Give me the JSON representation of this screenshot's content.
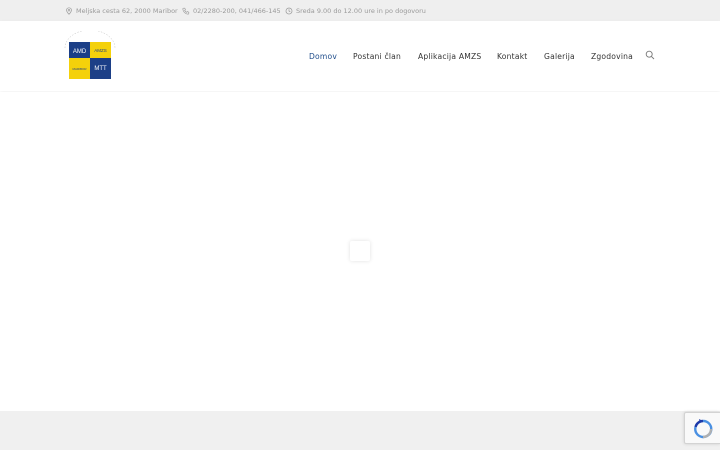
{
  "topbar": {
    "address": "Meljska cesta 62, 2000 Maribor",
    "phone": "02/2280-200, 041/466-145",
    "hours": "Sreda 9.00 do 12.00 ure in po dogovoru",
    "icons": [
      "location-icon",
      "phone-icon",
      "clock-icon"
    ]
  },
  "logo": {
    "tl": "AMD",
    "tr": "AMZS",
    "bl": "MARIBOR",
    "br": "MTT"
  },
  "nav": {
    "items": [
      {
        "label": "Domov",
        "active": true
      },
      {
        "label": "Postani član"
      },
      {
        "label": "Aplikacija AMZS"
      },
      {
        "label": "Kontakt"
      },
      {
        "label": "Galerija"
      },
      {
        "label": "Zgodovina"
      }
    ],
    "search_icon": "search-icon"
  },
  "colors": {
    "accent": "#1e4c8a",
    "logo_yellow": "#f4d10b",
    "logo_blue": "#1c3f87",
    "topbar_bg": "#efefef",
    "footer_bg": "#f0f0f0"
  },
  "recaptcha": {
    "icon": "recaptcha-icon"
  }
}
